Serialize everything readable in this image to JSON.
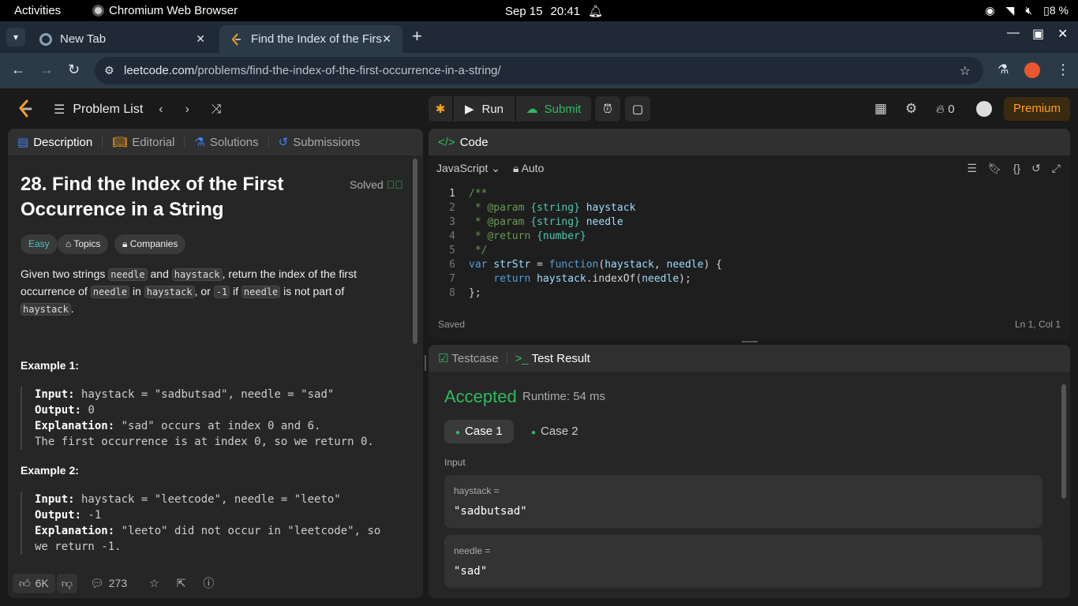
{
  "system_bar": {
    "activities": "Activities",
    "app_name": "Chromium Web Browser",
    "date": "Sep 15",
    "time": "20:41",
    "battery": "8 %"
  },
  "browser": {
    "tabs": [
      {
        "label": "New Tab"
      },
      {
        "label": "Find the Index of the Firs"
      }
    ],
    "url_host": "leetcode.com",
    "url_path": "/problems/find-the-index-of-the-first-occurrence-in-a-string/"
  },
  "header": {
    "problem_list": "Problem List",
    "run": "Run",
    "submit": "Submit",
    "streak": "0",
    "premium": "Premium"
  },
  "left_tabs": {
    "description": "Description",
    "editorial": "Editorial",
    "solutions": "Solutions",
    "submissions": "Submissions"
  },
  "problem": {
    "title": "28. Find the Index of the First Occurrence in a String",
    "status": "Solved",
    "tags": {
      "difficulty": "Easy",
      "topics": "Topics",
      "companies": "Companies"
    },
    "desc": {
      "p1": "Given two strings ",
      "c1": "needle",
      "p2": " and ",
      "c2": "haystack",
      "p3": ", return the index of the first occurrence of ",
      "c3": "needle",
      "p4": " in ",
      "c4": "haystack",
      "p5": ", or ",
      "c5": "-1",
      "p6": " if ",
      "c6": "needle",
      "p7": " is not part of ",
      "c7": "haystack",
      "p8": "."
    },
    "examples": [
      {
        "heading": "Example 1:",
        "input_label": "Input:",
        "input": " haystack = \"sadbutsad\", needle = \"sad\"",
        "output_label": "Output:",
        "output": " 0",
        "expl_label": "Explanation:",
        "expl": " \"sad\" occurs at index 0 and 6.",
        "expl2": "The first occurrence is at index 0, so we return 0."
      },
      {
        "heading": "Example 2:",
        "input_label": "Input:",
        "input": " haystack = \"leetcode\", needle = \"leeto\"",
        "output_label": "Output:",
        "output": " -1",
        "expl_label": "Explanation:",
        "expl": " \"leeto\" did not occur in \"leetcode\", so",
        "expl2": "we return -1."
      }
    ],
    "footer": {
      "likes": "6K",
      "comments": "273"
    }
  },
  "code": {
    "heading": "Code",
    "language": "JavaScript",
    "mode": "Auto",
    "line_numbers": [
      "1",
      "2",
      "3",
      "4",
      "5",
      "6",
      "7",
      "8"
    ],
    "saved": "Saved",
    "cursor": "Ln 1, Col 1"
  },
  "result": {
    "testcase_tab": "Testcase",
    "result_tab": "Test Result",
    "status": "Accepted",
    "runtime": "Runtime: 54 ms",
    "cases": [
      "Case 1",
      "Case 2"
    ],
    "input_label": "Input",
    "inputs": [
      {
        "key": "haystack =",
        "value": "\"sadbutsad\""
      },
      {
        "key": "needle =",
        "value": "\"sad\""
      }
    ]
  }
}
